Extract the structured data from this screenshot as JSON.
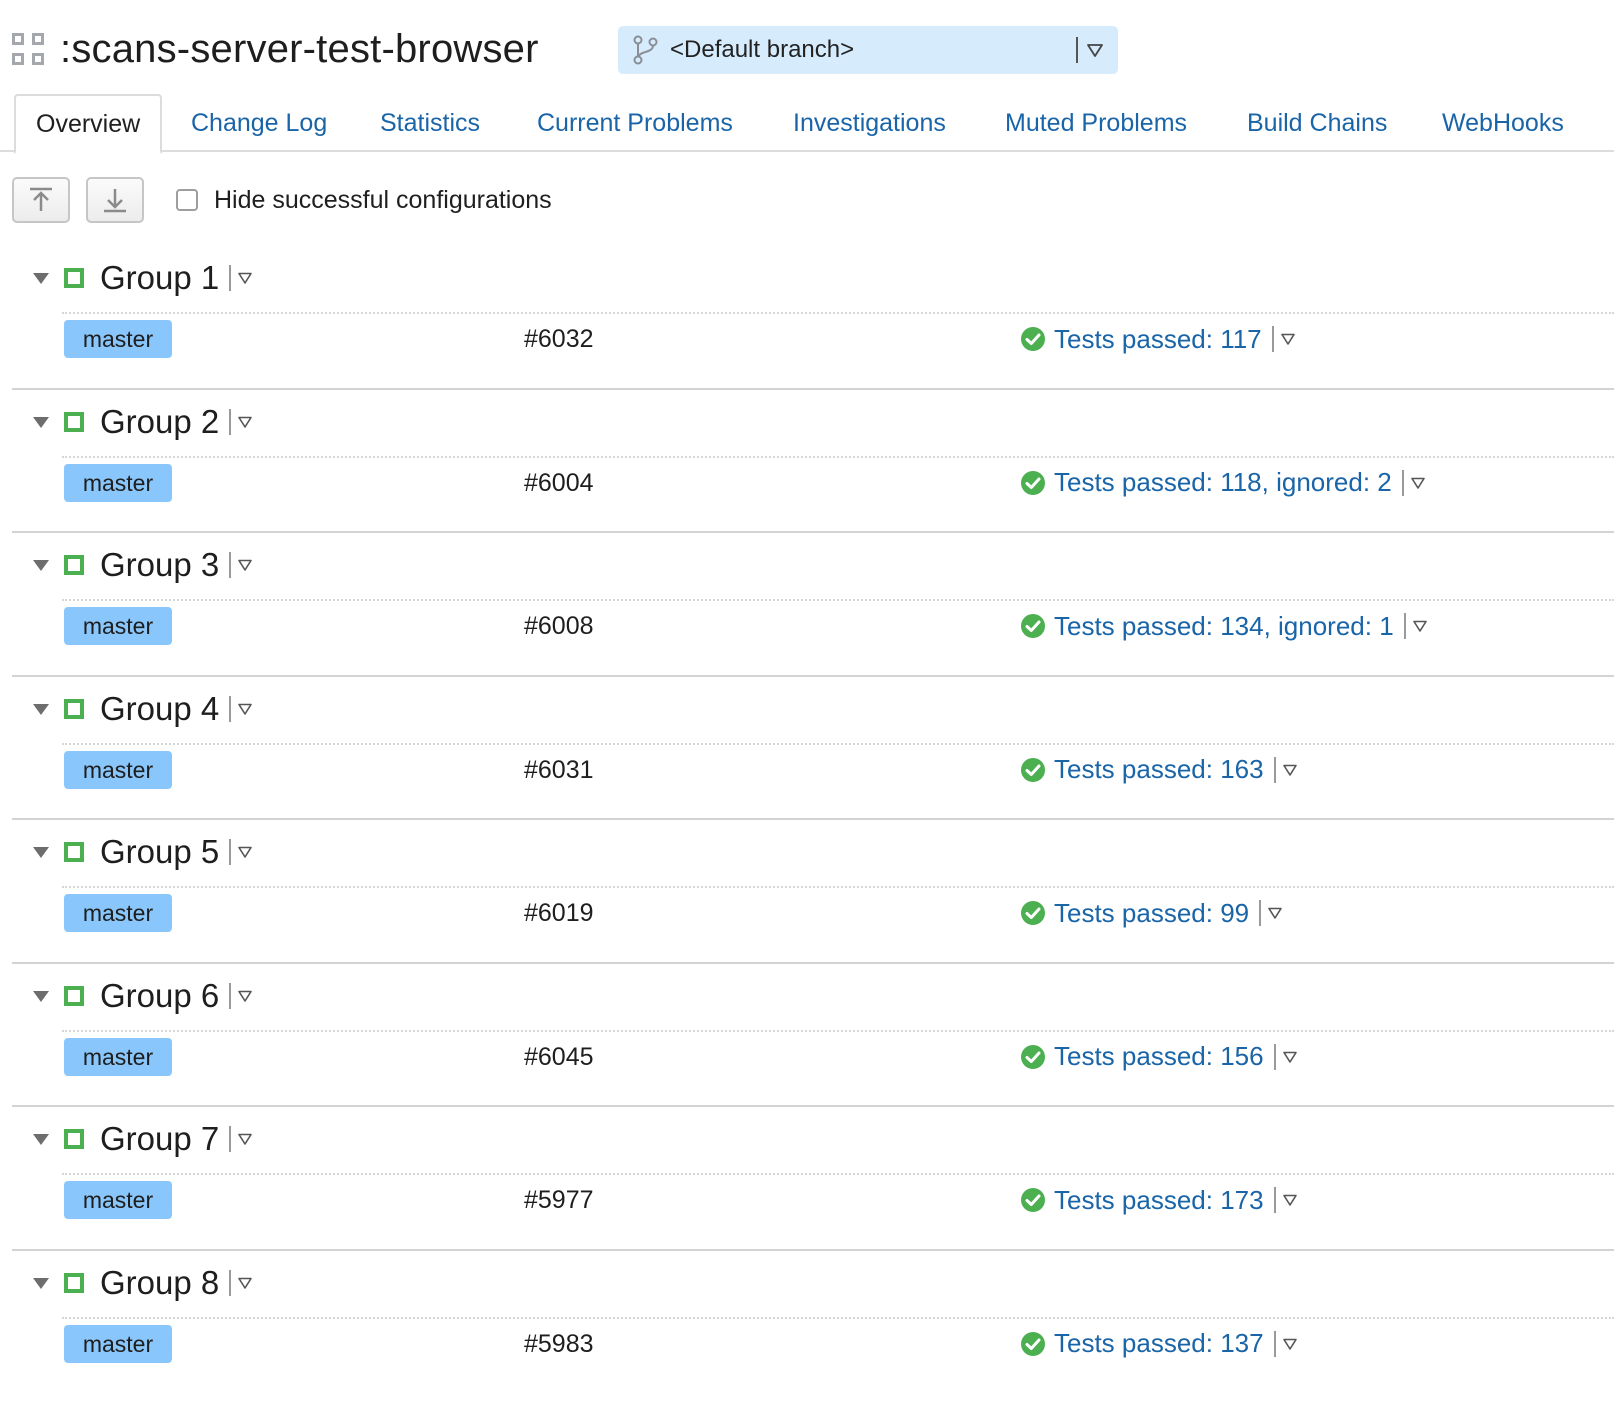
{
  "header": {
    "title": ":scans-server-test-browser",
    "branch_selector": "<Default branch>"
  },
  "tabs": [
    {
      "label": "Overview",
      "active": true
    },
    {
      "label": "Change Log",
      "active": false
    },
    {
      "label": "Statistics",
      "active": false
    },
    {
      "label": "Current Problems",
      "active": false
    },
    {
      "label": "Investigations",
      "active": false
    },
    {
      "label": "Muted Problems",
      "active": false
    },
    {
      "label": "Build Chains",
      "active": false
    },
    {
      "label": "WebHooks",
      "active": false
    }
  ],
  "toolbar": {
    "collapse_all_icon": "collapse-all-icon",
    "expand_all_icon": "expand-all-icon",
    "hide_successful_label": "Hide successful configurations",
    "hide_successful_checked": false
  },
  "colors": {
    "link": "#1a64a8",
    "branch_tag": "#89c6fb",
    "branch_selector_bg": "#d6ecfd",
    "success": "#4caf50"
  },
  "groups": [
    {
      "name": "Group 1",
      "branch": "master",
      "build": "#6032",
      "status": "Tests passed: 117"
    },
    {
      "name": "Group 2",
      "branch": "master",
      "build": "#6004",
      "status": "Tests passed: 118, ignored: 2"
    },
    {
      "name": "Group 3",
      "branch": "master",
      "build": "#6008",
      "status": "Tests passed: 134, ignored: 1"
    },
    {
      "name": "Group 4",
      "branch": "master",
      "build": "#6031",
      "status": "Tests passed: 163"
    },
    {
      "name": "Group 5",
      "branch": "master",
      "build": "#6019",
      "status": "Tests passed: 99"
    },
    {
      "name": "Group 6",
      "branch": "master",
      "build": "#6045",
      "status": "Tests passed: 156"
    },
    {
      "name": "Group 7",
      "branch": "master",
      "build": "#5977",
      "status": "Tests passed: 173"
    },
    {
      "name": "Group 8",
      "branch": "master",
      "build": "#5983",
      "status": "Tests passed: 137"
    }
  ]
}
